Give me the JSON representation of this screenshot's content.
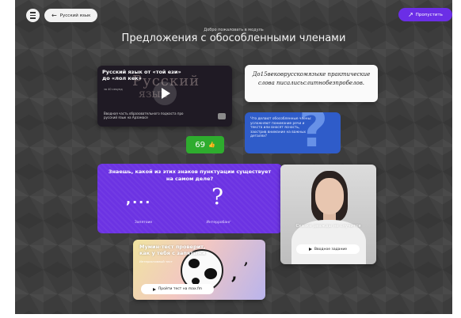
{
  "header": {
    "back_label": "Русский язык",
    "skip_label": "Пропустить"
  },
  "intro": {
    "welcome": "Добро пожаловать в модуль",
    "title": "Предложения с обособленными членами"
  },
  "video_card": {
    "title": "Русский язык от «той ези» до «лол кек»",
    "background_word": "Русский",
    "background_word2": "язык",
    "subtitle": "за 40 секунд",
    "description": "Вводная часть образовательного подкаста про русский язык на Арзамасе"
  },
  "handwritten_card": {
    "text": "До15вековрусскомязыке практическиеслова писалисьслитнобезпробелов."
  },
  "question_card": {
    "text": "Что делают обособленные члены: усложняют понимание речи и текста или вносят ясность, заострив внимание на важных деталях?",
    "symbol": "?"
  },
  "likes": {
    "count": "69",
    "icon": "thumbs-up-icon"
  },
  "punctuation_card": {
    "question": "Знаешь, какой из этих знаков пунктуации существует на самом деле?",
    "option1_mark": ",...",
    "option2_mark": "?",
    "option1_label": "Запятоие",
    "option2_label": "Интерробанг"
  },
  "photo_card": {
    "caption": "Сказке дважды не случится",
    "button_label": "Вводное задание"
  },
  "meme_card": {
    "title": "Мумин-тест проверит, как у тебя с запятыми",
    "subtitle": "Интерактивный тест",
    "button_label": "Пройти тест на max.fm"
  },
  "colors": {
    "accent": "#6b2ee6",
    "likes_green": "#2eac2e",
    "question_blue": "#2f5cc9",
    "punct_purple": "#6c33e3"
  }
}
